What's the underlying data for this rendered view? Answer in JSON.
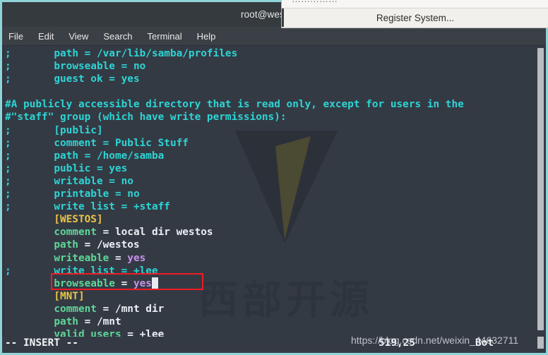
{
  "window": {
    "title": "root@westoslin",
    "menu": [
      "File",
      "Edit",
      "View",
      "Search",
      "Terminal",
      "Help"
    ]
  },
  "popup": {
    "top_strip_text": "……………",
    "label": "Register System..."
  },
  "editor": {
    "mode": "-- INSERT --",
    "cursor_position": "519,25",
    "scroll_location": "Bot",
    "lines": [
      {
        "prefix": ";",
        "indent": 8,
        "segments": [
          {
            "text": "path = /var/lib/samba/profiles",
            "cls": "c-comment"
          }
        ],
        "prefix_cls": "c-comment"
      },
      {
        "prefix": ";",
        "indent": 8,
        "segments": [
          {
            "text": "browseable = no",
            "cls": "c-comment"
          }
        ],
        "prefix_cls": "c-comment"
      },
      {
        "prefix": ";",
        "indent": 8,
        "segments": [
          {
            "text": "guest ok = yes",
            "cls": "c-comment"
          }
        ],
        "prefix_cls": "c-comment"
      },
      {
        "prefix": "",
        "indent": 0,
        "segments": []
      },
      {
        "prefix": "#",
        "indent": 1,
        "segments": [
          {
            "text": "A publicly accessible directory that is read only, except for users in the",
            "cls": "c-comment"
          }
        ],
        "prefix_cls": "c-comment"
      },
      {
        "prefix": "#",
        "indent": 1,
        "segments": [
          {
            "text": "\"staff\" group (which have write permissions):",
            "cls": "c-comment"
          }
        ],
        "prefix_cls": "c-comment"
      },
      {
        "prefix": ";",
        "indent": 8,
        "segments": [
          {
            "text": "[public]",
            "cls": "c-comment"
          }
        ],
        "prefix_cls": "c-comment"
      },
      {
        "prefix": ";",
        "indent": 8,
        "segments": [
          {
            "text": "comment = Public Stuff",
            "cls": "c-comment"
          }
        ],
        "prefix_cls": "c-comment"
      },
      {
        "prefix": ";",
        "indent": 8,
        "segments": [
          {
            "text": "path = /home/samba",
            "cls": "c-comment"
          }
        ],
        "prefix_cls": "c-comment"
      },
      {
        "prefix": ";",
        "indent": 8,
        "segments": [
          {
            "text": "public = yes",
            "cls": "c-comment"
          }
        ],
        "prefix_cls": "c-comment"
      },
      {
        "prefix": ";",
        "indent": 8,
        "segments": [
          {
            "text": "writable = no",
            "cls": "c-comment"
          }
        ],
        "prefix_cls": "c-comment"
      },
      {
        "prefix": ";",
        "indent": 8,
        "segments": [
          {
            "text": "printable = no",
            "cls": "c-comment"
          }
        ],
        "prefix_cls": "c-comment"
      },
      {
        "prefix": ";",
        "indent": 8,
        "segments": [
          {
            "text": "write list = +staff",
            "cls": "c-comment"
          }
        ],
        "prefix_cls": "c-comment"
      },
      {
        "prefix": "",
        "indent": 8,
        "segments": [
          {
            "text": "[WESTOS]",
            "cls": "c-section"
          }
        ]
      },
      {
        "prefix": "",
        "indent": 8,
        "segments": [
          {
            "text": "comment",
            "cls": "c-key"
          },
          {
            "text": " = local dir westos",
            "cls": "c-plain"
          }
        ]
      },
      {
        "prefix": "",
        "indent": 8,
        "segments": [
          {
            "text": "path",
            "cls": "c-key"
          },
          {
            "text": " = /westos",
            "cls": "c-plain"
          }
        ]
      },
      {
        "prefix": "",
        "indent": 8,
        "segments": [
          {
            "text": "writeable",
            "cls": "c-key"
          },
          {
            "text": " = ",
            "cls": "c-plain"
          },
          {
            "text": "yes",
            "cls": "c-val"
          }
        ]
      },
      {
        "prefix": ";",
        "indent": 8,
        "segments": [
          {
            "text": "write list = +lee",
            "cls": "c-comment"
          }
        ],
        "prefix_cls": "c-comment"
      },
      {
        "prefix": "",
        "indent": 8,
        "segments": [
          {
            "text": "browseable",
            "cls": "c-key"
          },
          {
            "text": " = ",
            "cls": "c-plain"
          },
          {
            "text": "yes",
            "cls": "c-val"
          }
        ],
        "cursor": true
      },
      {
        "prefix": "",
        "indent": 8,
        "segments": [
          {
            "text": "[MNT]",
            "cls": "c-section"
          }
        ]
      },
      {
        "prefix": "",
        "indent": 8,
        "segments": [
          {
            "text": "comment",
            "cls": "c-key"
          },
          {
            "text": " = /mnt dir",
            "cls": "c-plain"
          }
        ]
      },
      {
        "prefix": "",
        "indent": 8,
        "segments": [
          {
            "text": "path",
            "cls": "c-key"
          },
          {
            "text": " = /mnt",
            "cls": "c-plain"
          }
        ]
      },
      {
        "prefix": "",
        "indent": 8,
        "segments": [
          {
            "text": "valid users",
            "cls": "c-key"
          },
          {
            "text": " = +lee",
            "cls": "c-plain"
          }
        ]
      }
    ]
  },
  "watermark": {
    "cjk_text": "西部开源",
    "url": "https://blog.csdn.net/weixin_44632711"
  },
  "colors": {
    "terminal_bg": "#343a44",
    "frame": "#8fd4d8",
    "comment": "#2dd4d4",
    "section": "#e8c547",
    "key": "#5fd898",
    "value": "#c792ea",
    "highlight_box": "#ee1c25"
  }
}
